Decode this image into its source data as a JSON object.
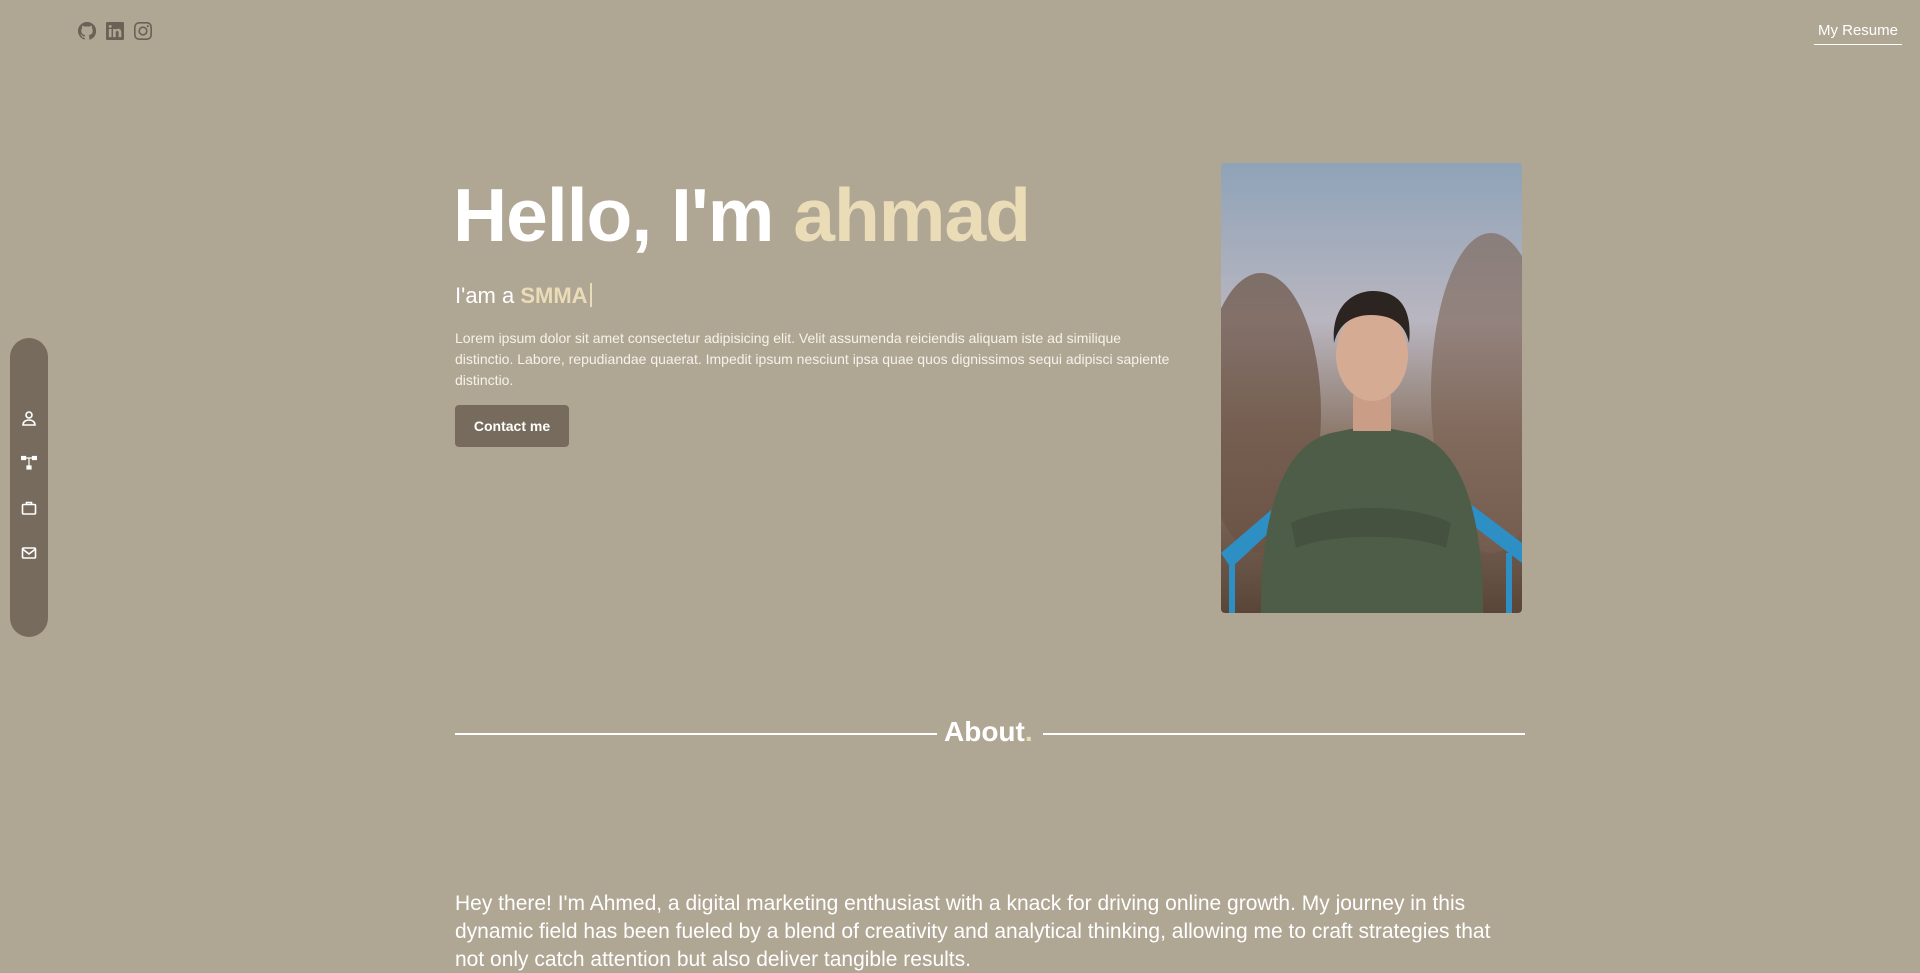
{
  "header": {
    "social": [
      {
        "name": "github-icon"
      },
      {
        "name": "linkedin-icon"
      },
      {
        "name": "instagram-icon"
      }
    ],
    "resume_label": "My Resume"
  },
  "side_nav": {
    "items": [
      {
        "icon": "person-icon"
      },
      {
        "icon": "hierarchy-icon"
      },
      {
        "icon": "briefcase-icon"
      },
      {
        "icon": "mail-icon"
      }
    ]
  },
  "hero": {
    "greeting": "Hello, I'm ",
    "name": "ahmad",
    "role_prefix": "I'am a ",
    "role": "SMMA",
    "intro": "Lorem ipsum dolor sit amet consectetur adipisicing elit. Velit assumenda reiciendis aliquam iste ad similique distinctio. Labore, repudiandae quaerat. Impedit ipsum nesciunt ipsa quae quos dignissimos sequi adipisci sapiente distinctio.",
    "contact_label": "Contact me"
  },
  "about": {
    "title": "About",
    "title_dot": ".",
    "text": "Hey there! I'm Ahmed, a digital marketing enthusiast with a knack for driving online growth. My journey in this dynamic field has been fueled by a blend of creativity and analytical thinking, allowing me to craft strategies that not only catch attention but also deliver tangible results."
  },
  "colors": {
    "background": "#b0a694",
    "accent": "#ebdcb8",
    "button": "#776b5d",
    "icon": "#6b6156"
  }
}
